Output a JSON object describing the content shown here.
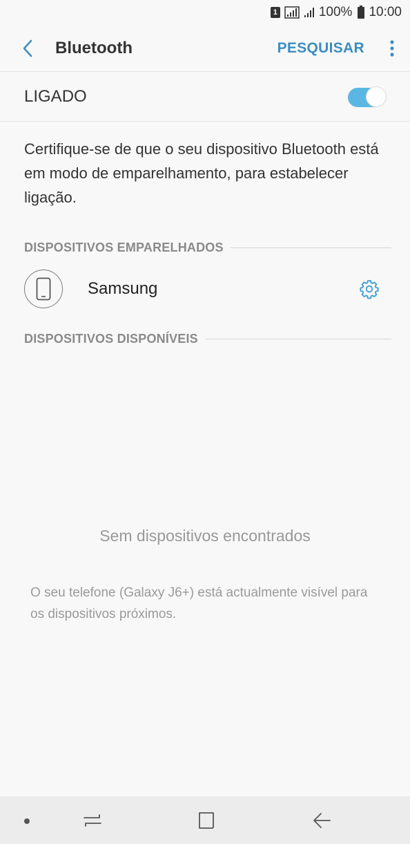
{
  "status_bar": {
    "sim_badge": "1",
    "battery": "100%",
    "time": "10:00"
  },
  "header": {
    "title": "Bluetooth",
    "search_label": "PESQUISAR"
  },
  "toggle": {
    "label": "LIGADO",
    "on": true
  },
  "description": "Certifique-se de que o seu dispositivo Bluetooth está em modo de emparelhamento, para estabelecer ligação.",
  "paired": {
    "title": "DISPOSITIVOS EMPARELHADOS",
    "devices": [
      {
        "name": "Samsung",
        "icon": "phone-icon"
      }
    ]
  },
  "available": {
    "title": "DISPOSITIVOS DISPONÍVEIS",
    "empty_message": "Sem dispositivos encontrados"
  },
  "visibility_message": "O seu telefone (Galaxy J6+) está actualmente visível para os dispositivos próximos.",
  "colors": {
    "accent": "#3d8ec0",
    "switch_on": "#5ab7e3"
  }
}
